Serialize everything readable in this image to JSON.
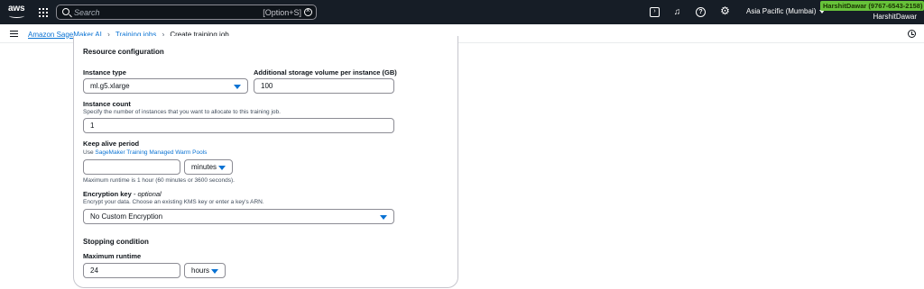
{
  "topbar": {
    "logo_text": "aws",
    "search_placeholder": "Search",
    "search_shortcut": "[Option+S]",
    "region": "Asia Pacific (Mumbai)",
    "account_badge": "HarshitDawar (9767-6543-2158)",
    "account_name": "HarshitDawar",
    "icons": [
      "grid-icon",
      "search-icon",
      "clear-icon",
      "terminal-icon",
      "bell-icon",
      "help-icon",
      "gear-icon"
    ]
  },
  "breadcrumb": {
    "items": [
      "Amazon SageMaker AI",
      "Training jobs"
    ],
    "current": "Create training job"
  },
  "form": {
    "section_title": "Resource configuration",
    "instance_type": {
      "label": "Instance type",
      "value": "ml.g5.xlarge"
    },
    "storage": {
      "label": "Additional storage volume per instance (GB)",
      "value": "100"
    },
    "instance_count": {
      "label": "Instance count",
      "description": "Specify the number of instances that you want to allocate to this training job.",
      "value": "1"
    },
    "keep_alive": {
      "label": "Keep alive period",
      "description_prefix": "Use",
      "link_text": "SageMaker Training Managed Warm Pools",
      "value": "",
      "unit": "minutes",
      "hint": "Maximum runtime is 1 hour (60 minutes or 3600 seconds)."
    },
    "encryption": {
      "label": "Encryption key",
      "optional": "- optional",
      "description": "Encrypt your data. Choose an existing KMS key or enter a key's ARN.",
      "value": "No Custom Encryption"
    },
    "stopping_title": "Stopping condition",
    "max_runtime": {
      "label": "Maximum runtime",
      "value": "24",
      "unit": "hours"
    }
  },
  "colors": {
    "nav_bg": "#161d26",
    "link": "#0972d3",
    "badge": "#67c23a"
  }
}
